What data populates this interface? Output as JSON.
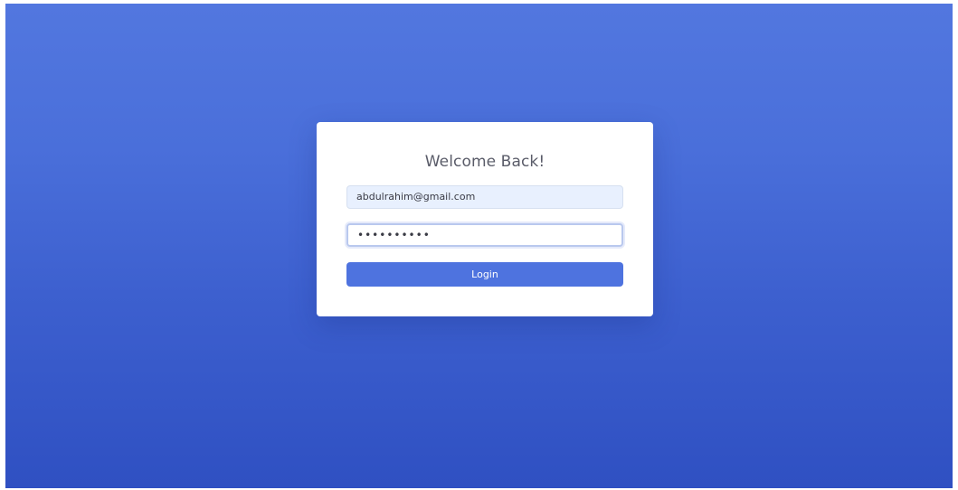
{
  "login": {
    "title": "Welcome Back!",
    "email_value": "abdulrahim@gmail.com",
    "password_value": "••••••••••",
    "login_label": "Login"
  },
  "colors": {
    "accent": "#4e73df",
    "background_top": "#5277df",
    "background_bottom": "#2f50c2",
    "email_field_bg": "#e8f0fe"
  }
}
